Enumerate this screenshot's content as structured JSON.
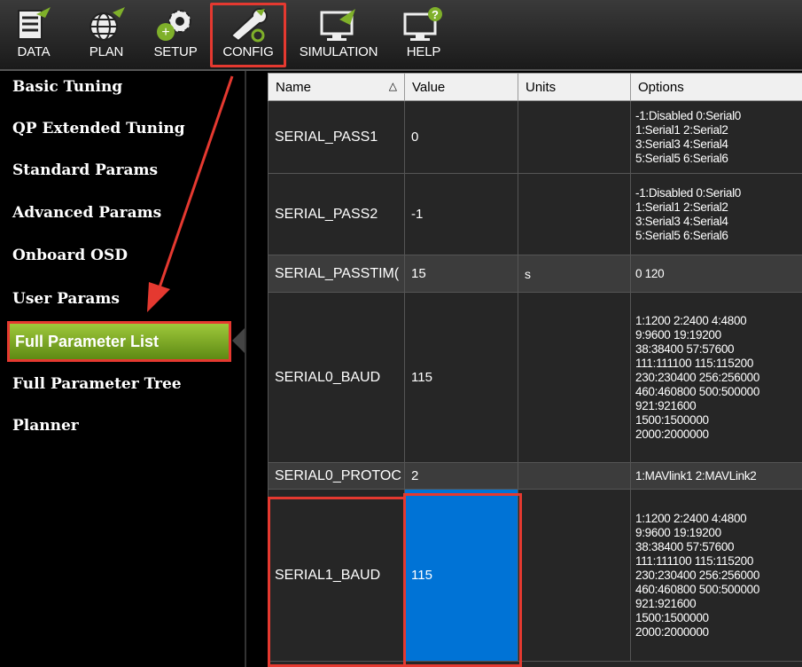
{
  "toolbar": {
    "buttons": [
      {
        "label": "DATA",
        "icon": "data-icon"
      },
      {
        "label": "PLAN",
        "icon": "globe-icon"
      },
      {
        "label": "SETUP",
        "icon": "gears-icon"
      },
      {
        "label": "CONFIG",
        "icon": "wrench-icon"
      },
      {
        "label": "SIMULATION",
        "icon": "monitor-plane-icon"
      },
      {
        "label": "HELP",
        "icon": "monitor-help-icon"
      }
    ],
    "active": "CONFIG"
  },
  "sidebar": {
    "items": [
      {
        "label": "Basic Tuning"
      },
      {
        "label": "QP Extended Tuning"
      },
      {
        "label": "Standard Params"
      },
      {
        "label": "Advanced Params"
      },
      {
        "label": "Onboard OSD"
      },
      {
        "label": "User Params"
      },
      {
        "label": "Full Parameter List"
      },
      {
        "label": "Full Parameter Tree"
      },
      {
        "label": "Planner"
      }
    ],
    "active": "Full Parameter List"
  },
  "table": {
    "columns": [
      "Name",
      "Value",
      "Units",
      "Options"
    ],
    "rows": [
      {
        "name": "SERIAL_PASS1",
        "value": "0",
        "units": "",
        "options": [
          "-1:Disabled 0:Serial0",
          "1:Serial1 2:Serial2",
          "3:Serial3 4:Serial4",
          "5:Serial5 6:Serial6"
        ]
      },
      {
        "name": "SERIAL_PASS2",
        "value": "-1",
        "units": "",
        "options": [
          "-1:Disabled 0:Serial0",
          "1:Serial1 2:Serial2",
          "3:Serial3 4:Serial4",
          "5:Serial5 6:Serial6"
        ]
      },
      {
        "name": "SERIAL_PASSTIM(",
        "value": "15",
        "units": "s",
        "options": [
          "0 120"
        ]
      },
      {
        "name": "SERIAL0_BAUD",
        "value": "115",
        "units": "",
        "options": [
          "1:1200 2:2400 4:4800",
          "9:9600 19:19200",
          "38:38400 57:57600",
          "111:111100 115:115200",
          "230:230400 256:256000",
          "460:460800 500:500000",
          "921:921600",
          "1500:1500000",
          "2000:2000000"
        ]
      },
      {
        "name": "SERIAL0_PROTOC",
        "value": "2",
        "units": "",
        "options": [
          "1:MAVlink1 2:MAVLink2"
        ]
      },
      {
        "name": "SERIAL1_BAUD",
        "value": "115",
        "units": "",
        "options": [
          "1:1200 2:2400 4:4800",
          "9:9600 19:19200",
          "38:38400 57:57600",
          "111:111100 115:115200",
          "230:230400 256:256000",
          "460:460800 500:500000",
          "921:921600",
          "1500:1500000",
          "2000:2000000"
        ]
      }
    ],
    "selected_row": "SERIAL1_BAUD"
  },
  "colors": {
    "highlight": "#e53930",
    "selection": "#0073d6",
    "active_tab": "#7fb02a"
  }
}
